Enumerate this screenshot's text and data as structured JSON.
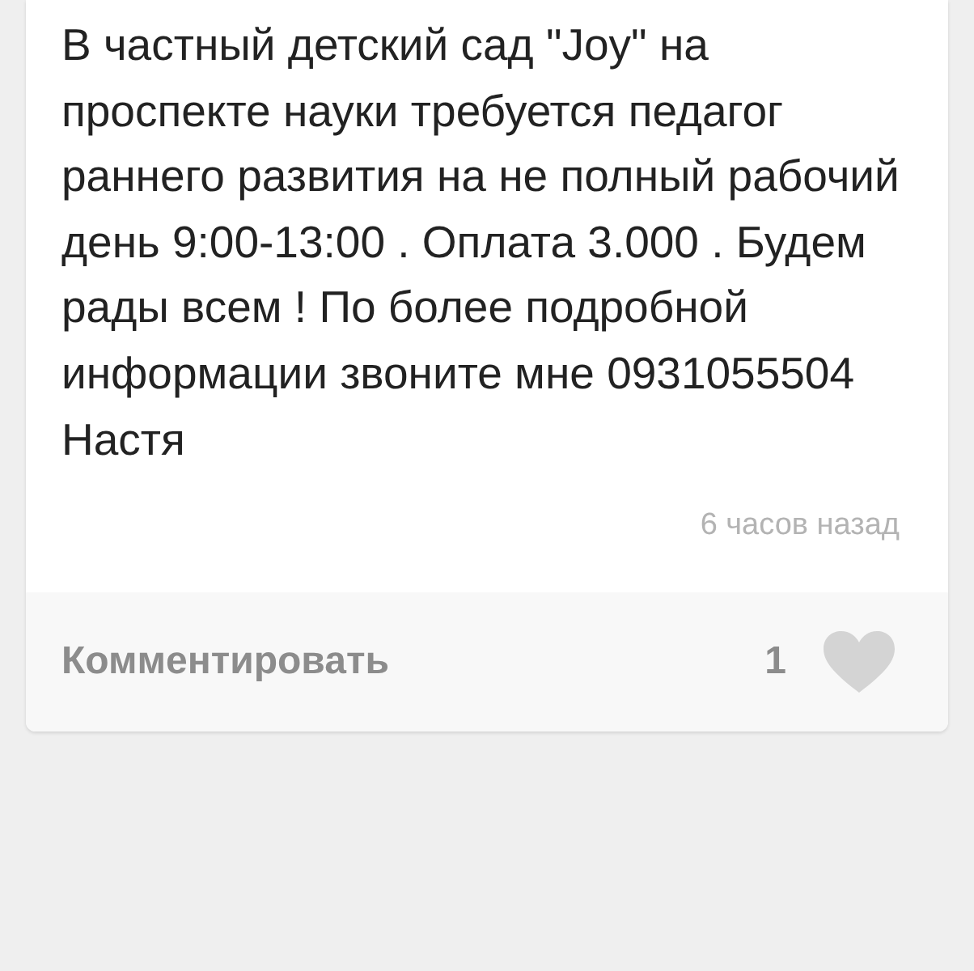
{
  "post": {
    "text": "В частный детский сад \"Joy\" на проспекте науки требуется педагог раннего развития на не полный рабочий день 9:00-13:00 . Оплата 3.000 . Будем рады всем ! По более подробной информации звоните мне 0931055504 Настя",
    "time": "6 часов назад"
  },
  "footer": {
    "comment": "Комментировать",
    "likes": "1",
    "liked": false
  }
}
